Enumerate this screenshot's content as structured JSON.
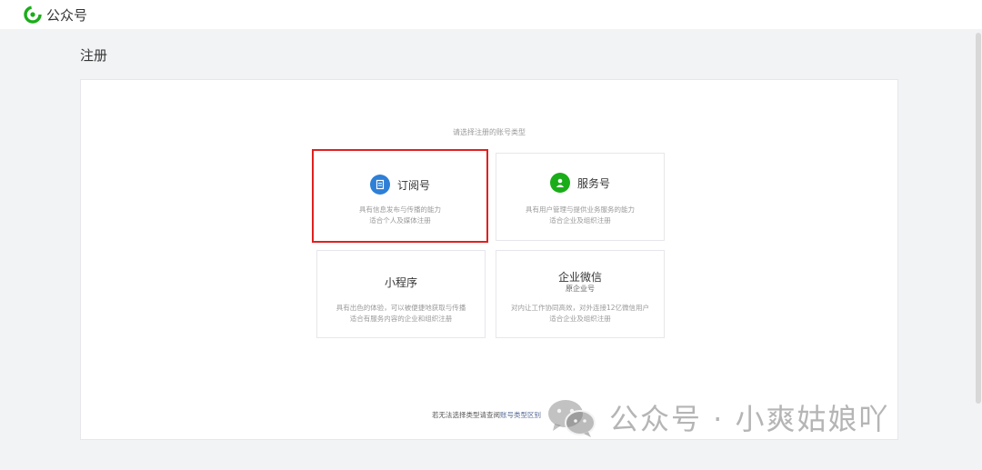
{
  "topbar": {
    "logo_text": "公众号"
  },
  "page": {
    "title": "注册"
  },
  "panel": {
    "prompt": "请选择注册的账号类型",
    "cards": [
      {
        "name": "订阅号",
        "sub": "",
        "desc1": "具有信息发布与传播的能力",
        "desc2": "适合个人及媒体注册",
        "icon": "document-icon",
        "icon_color": "#2e7fd6",
        "selected": true
      },
      {
        "name": "服务号",
        "sub": "",
        "desc1": "具有用户管理与提供业务服务的能力",
        "desc2": "适合企业及组织注册",
        "icon": "user-icon",
        "icon_color": "#1aad19",
        "selected": false
      },
      {
        "name": "小程序",
        "sub": "",
        "desc1": "具有出色的体验，可以被便捷地获取与传播",
        "desc2": "适合有服务内容的企业和组织注册",
        "icon": "",
        "icon_color": "",
        "selected": false
      },
      {
        "name": "企业微信",
        "sub": "原企业号",
        "desc1": "对内让工作协同高效，对外连接12亿微信用户",
        "desc2": "适合企业及组织注册",
        "icon": "",
        "icon_color": "",
        "selected": false
      }
    ],
    "footer_prefix": "若无法选择类型请查阅",
    "footer_link": "账号类型区别"
  },
  "watermark": {
    "text": "公众号 · 小爽姑娘吖"
  },
  "colors": {
    "selected_border": "#e02020",
    "link": "#576b95",
    "brand_green": "#1aad19"
  }
}
